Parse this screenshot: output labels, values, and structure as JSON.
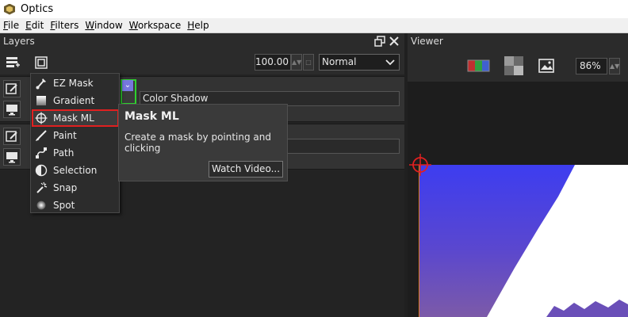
{
  "window": {
    "title": "Optics"
  },
  "menubar": {
    "items": [
      "File",
      "Edit",
      "Filters",
      "Window",
      "Workspace",
      "Help"
    ]
  },
  "layers_panel": {
    "title": "Layers",
    "opacity": "100.00",
    "blend_mode": "Normal",
    "layers": [
      {
        "name": "Color Shadow"
      },
      {
        "name": ""
      }
    ]
  },
  "popup_menu": {
    "items": [
      {
        "label": "EZ Mask",
        "icon": "brush-icon"
      },
      {
        "label": "Gradient",
        "icon": "gradient-icon"
      },
      {
        "label": "Mask ML",
        "icon": "crosshair-icon",
        "active": true
      },
      {
        "label": "Paint",
        "icon": "paint-brush-icon"
      },
      {
        "label": "Path",
        "icon": "path-icon"
      },
      {
        "label": "Selection",
        "icon": "selection-icon"
      },
      {
        "label": "Snap",
        "icon": "magic-wand-icon"
      },
      {
        "label": "Spot",
        "icon": "spot-icon"
      }
    ]
  },
  "tooltip": {
    "title": "Mask ML",
    "description": "Create a mask by pointing and clicking",
    "button_label": "Watch Video..."
  },
  "viewer_panel": {
    "title": "Viewer",
    "zoom": "86%"
  },
  "colors": {
    "accent_red": "#e02020",
    "thumb_border_green": "#2ed12e",
    "crosshair_red": "#e02020",
    "canvas_blue": "#3d3df0"
  }
}
